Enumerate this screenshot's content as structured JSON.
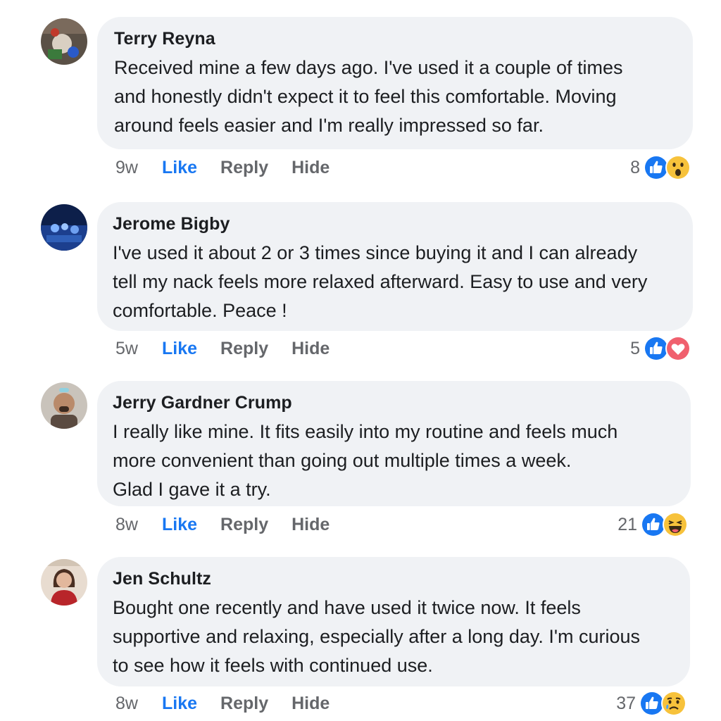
{
  "comments": [
    {
      "author": "Terry Reyna",
      "text": "Received mine a few days ago. I've used it a couple of times\nand honestly didn't expect it to feel this comfortable. Moving\naround feels easier and I'm really impressed so far.",
      "time": "9w",
      "like_label": "Like",
      "reply_label": "Reply",
      "hide_label": "Hide",
      "reaction_count": "8",
      "reactions": [
        "like-icon",
        "wow-icon"
      ]
    },
    {
      "author": "Jerome Bigby",
      "text": "I've used it about 2 or 3 times since buying it and I can already\ntell my nack feels more relaxed afterward. Easy to use and very\ncomfortable. Peace !",
      "time": "5w",
      "like_label": "Like",
      "reply_label": "Reply",
      "hide_label": "Hide",
      "reaction_count": "5",
      "reactions": [
        "like-icon",
        "love-icon"
      ]
    },
    {
      "author": "Jerry Gardner Crump",
      "text": "I really like mine. It fits easily into my routine and feels much\nmore convenient than going out multiple times a week.\nGlad I gave it a try.",
      "time": "8w",
      "like_label": "Like",
      "reply_label": "Reply",
      "hide_label": "Hide",
      "reaction_count": "21",
      "reactions": [
        "like-icon",
        "haha-icon"
      ]
    },
    {
      "author": "Jen Schultz",
      "text": "Bought one recently and have used it twice now. It feels\nsupportive and relaxing, especially after a long day. I'm curious\nto see how it feels with continued use.",
      "time": "8w",
      "like_label": "Like",
      "reply_label": "Reply",
      "hide_label": "Hide",
      "reaction_count": "37",
      "reactions": [
        "like-icon",
        "sad-icon"
      ]
    }
  ],
  "colors": {
    "like_blue": "#1877f2",
    "bubble_bg": "#f0f2f5",
    "secondary_text": "#65676b",
    "reaction_yellow": "#f7c23b",
    "love_red": "#f0606e"
  }
}
